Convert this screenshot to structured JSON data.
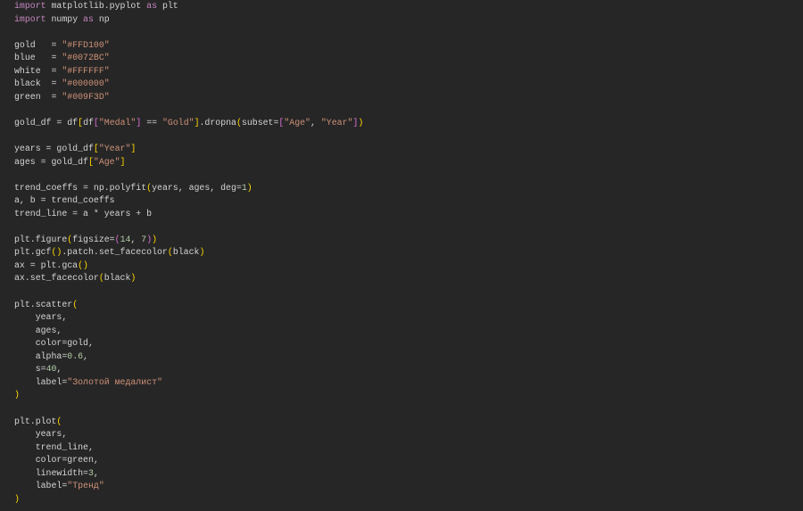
{
  "code_lines": [
    [
      [
        "import",
        "k"
      ],
      [
        " matplotlib.pyplot ",
        "t"
      ],
      [
        "as",
        "k"
      ],
      [
        " plt",
        "t"
      ]
    ],
    [
      [
        "import",
        "k"
      ],
      [
        " numpy ",
        "t"
      ],
      [
        "as",
        "k"
      ],
      [
        " np",
        "t"
      ]
    ],
    [],
    [
      [
        "gold   = ",
        "t"
      ],
      [
        "\"#FFD100\"",
        "s"
      ]
    ],
    [
      [
        "blue   = ",
        "t"
      ],
      [
        "\"#0072BC\"",
        "s"
      ]
    ],
    [
      [
        "white  = ",
        "t"
      ],
      [
        "\"#FFFFFF\"",
        "s"
      ]
    ],
    [
      [
        "black  = ",
        "t"
      ],
      [
        "\"#000000\"",
        "s"
      ]
    ],
    [
      [
        "green  = ",
        "t"
      ],
      [
        "\"#009F3D\"",
        "s"
      ]
    ],
    [],
    [
      [
        "gold_df = df",
        "t"
      ],
      [
        "[",
        "b1"
      ],
      [
        "df",
        "t"
      ],
      [
        "[",
        "b2"
      ],
      [
        "\"Medal\"",
        "s"
      ],
      [
        "]",
        "b2"
      ],
      [
        " == ",
        "t"
      ],
      [
        "\"Gold\"",
        "s"
      ],
      [
        "]",
        "b1"
      ],
      [
        ".dropna",
        "t"
      ],
      [
        "(",
        "b1"
      ],
      [
        "subset=",
        "t"
      ],
      [
        "[",
        "b2"
      ],
      [
        "\"Age\"",
        "s"
      ],
      [
        ", ",
        "t"
      ],
      [
        "\"Year\"",
        "s"
      ],
      [
        "]",
        "b2"
      ],
      [
        ")",
        "b1"
      ]
    ],
    [],
    [
      [
        "years = gold_df",
        "t"
      ],
      [
        "[",
        "b1"
      ],
      [
        "\"Year\"",
        "s"
      ],
      [
        "]",
        "b1"
      ]
    ],
    [
      [
        "ages = gold_df",
        "t"
      ],
      [
        "[",
        "b1"
      ],
      [
        "\"Age\"",
        "s"
      ],
      [
        "]",
        "b1"
      ]
    ],
    [],
    [
      [
        "trend_coeffs = np.polyfit",
        "t"
      ],
      [
        "(",
        "b1"
      ],
      [
        "years, ages, deg=",
        "t"
      ],
      [
        "1",
        "n"
      ],
      [
        ")",
        "b1"
      ]
    ],
    [
      [
        "a, b = trend_coeffs",
        "t"
      ]
    ],
    [
      [
        "trend_line = a * years + b",
        "t"
      ]
    ],
    [],
    [
      [
        "plt.figure",
        "t"
      ],
      [
        "(",
        "b1"
      ],
      [
        "figsize=",
        "t"
      ],
      [
        "(",
        "b2"
      ],
      [
        "14",
        "n"
      ],
      [
        ", ",
        "t"
      ],
      [
        "7",
        "n"
      ],
      [
        ")",
        "b2"
      ],
      [
        ")",
        "b1"
      ]
    ],
    [
      [
        "plt.gcf",
        "t"
      ],
      [
        "()",
        "b1"
      ],
      [
        ".patch.set_facecolor",
        "t"
      ],
      [
        "(",
        "b1"
      ],
      [
        "black",
        "t"
      ],
      [
        ")",
        "b1"
      ]
    ],
    [
      [
        "ax = plt.gca",
        "t"
      ],
      [
        "()",
        "b1"
      ]
    ],
    [
      [
        "ax.set_facecolor",
        "t"
      ],
      [
        "(",
        "b1"
      ],
      [
        "black",
        "t"
      ],
      [
        ")",
        "b1"
      ]
    ],
    [],
    [
      [
        "plt.scatter",
        "t"
      ],
      [
        "(",
        "b1"
      ]
    ],
    [
      [
        "    years,",
        "t"
      ]
    ],
    [
      [
        "    ages,",
        "t"
      ]
    ],
    [
      [
        "    color=gold,",
        "t"
      ]
    ],
    [
      [
        "    alpha=",
        "t"
      ],
      [
        "0.6",
        "n"
      ],
      [
        ",",
        "t"
      ]
    ],
    [
      [
        "    s=",
        "t"
      ],
      [
        "40",
        "n"
      ],
      [
        ",",
        "t"
      ]
    ],
    [
      [
        "    label=",
        "t"
      ],
      [
        "\"Золотой медалист\"",
        "s"
      ]
    ],
    [
      [
        ")",
        "b1"
      ]
    ],
    [],
    [
      [
        "plt.plot",
        "t"
      ],
      [
        "(",
        "b1"
      ]
    ],
    [
      [
        "    years,",
        "t"
      ]
    ],
    [
      [
        "    trend_line,",
        "t"
      ]
    ],
    [
      [
        "    color=green,",
        "t"
      ]
    ],
    [
      [
        "    linewidth=",
        "t"
      ],
      [
        "3",
        "n"
      ],
      [
        ",",
        "t"
      ]
    ],
    [
      [
        "    label=",
        "t"
      ],
      [
        "\"Тренд\"",
        "s"
      ]
    ],
    [
      [
        ")",
        "b1"
      ]
    ]
  ]
}
